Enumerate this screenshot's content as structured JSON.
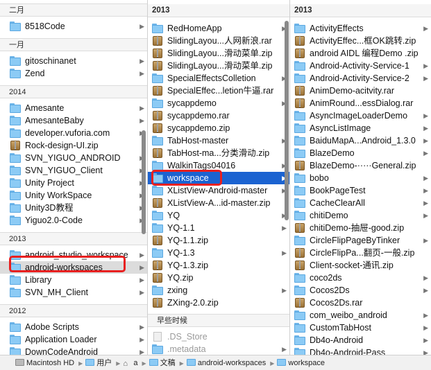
{
  "column1": {
    "sections": [
      {
        "header": "二月",
        "items": [
          {
            "label": "8518Code",
            "icon": "folder-icon",
            "arrow": true
          }
        ]
      },
      {
        "header": "一月",
        "items": [
          {
            "label": "gitoschinanet",
            "icon": "folder-icon",
            "arrow": true
          },
          {
            "label": "Zend",
            "icon": "folder-icon",
            "arrow": true
          }
        ]
      },
      {
        "header": "2014",
        "items": [
          {
            "label": "Amesante",
            "icon": "folder-icon",
            "arrow": true
          },
          {
            "label": "AmesanteBaby",
            "icon": "folder-icon",
            "arrow": true
          },
          {
            "label": "developer.vuforia.com",
            "icon": "folder-icon",
            "arrow": true
          },
          {
            "label": "Rock-design-UI.zip",
            "icon": "zip-icon",
            "arrow": false
          },
          {
            "label": "SVN_YIGUO_ANDROID",
            "icon": "folder-icon",
            "arrow": true
          },
          {
            "label": "SVN_YIGUO_Client",
            "icon": "folder-icon",
            "arrow": true
          },
          {
            "label": "Unity Project",
            "icon": "folder-icon",
            "arrow": true
          },
          {
            "label": "Unity WorkSpace",
            "icon": "folder-icon",
            "arrow": true
          },
          {
            "label": "Unity3D教程",
            "icon": "folder-icon",
            "arrow": true
          },
          {
            "label": "Yiguo2.0-Code",
            "icon": "folder-icon",
            "arrow": true
          }
        ]
      },
      {
        "header": "2013",
        "items": [
          {
            "label": "android_studio_workspace",
            "icon": "folder-icon",
            "arrow": true
          },
          {
            "label": "android-workspaces",
            "icon": "folder-icon",
            "arrow": true,
            "state": "highlighted"
          },
          {
            "label": "Library",
            "icon": "folder-icon",
            "arrow": true
          },
          {
            "label": "SVN_MH_Client",
            "icon": "folder-icon",
            "arrow": true
          }
        ]
      },
      {
        "header": "2012",
        "items": [
          {
            "label": "Adobe Scripts",
            "icon": "folder-icon",
            "arrow": true
          },
          {
            "label": "Application Loader",
            "icon": "folder-icon",
            "arrow": true
          },
          {
            "label": "DownCodeAndroid",
            "icon": "folder-icon",
            "arrow": true
          }
        ]
      }
    ]
  },
  "column2": {
    "header": "2013",
    "items": [
      {
        "label": "RedHomeApp",
        "icon": "folder-icon",
        "arrow": true
      },
      {
        "label": "SlidingLayou...人网新浪.rar",
        "icon": "zip-icon",
        "arrow": false
      },
      {
        "label": "SlidingLayou...滑动菜单.zip",
        "icon": "zip-icon",
        "arrow": false
      },
      {
        "label": "SlidingLayou...滑动菜单.zip",
        "icon": "zip-icon",
        "arrow": false
      },
      {
        "label": "SpecialEffectsColletion",
        "icon": "folder-icon",
        "arrow": true
      },
      {
        "label": "SpecialEffec...letion牛逼.rar",
        "icon": "zip-icon",
        "arrow": false
      },
      {
        "label": "sycappdemo",
        "icon": "folder-icon",
        "arrow": true
      },
      {
        "label": "sycappdemo.rar",
        "icon": "zip-icon",
        "arrow": false
      },
      {
        "label": "sycappdemo.zip",
        "icon": "zip-icon",
        "arrow": false
      },
      {
        "label": "TabHost-master",
        "icon": "folder-icon",
        "arrow": true
      },
      {
        "label": "TabHost-ma...分类滑动.zip",
        "icon": "zip-icon",
        "arrow": false
      },
      {
        "label": "WalkinTags04016",
        "icon": "folder-icon",
        "arrow": true
      },
      {
        "label": "workspace",
        "icon": "folder-icon",
        "arrow": true,
        "state": "selected"
      },
      {
        "label": "XListView-Android-master",
        "icon": "folder-icon",
        "arrow": true
      },
      {
        "label": "XListView-A...id-master.zip",
        "icon": "zip-icon",
        "arrow": false
      },
      {
        "label": "YQ",
        "icon": "folder-icon",
        "arrow": true
      },
      {
        "label": "YQ-1.1",
        "icon": "folder-icon",
        "arrow": true
      },
      {
        "label": "YQ-1.1.zip",
        "icon": "zip-icon",
        "arrow": false
      },
      {
        "label": "YQ-1.3",
        "icon": "folder-icon",
        "arrow": true
      },
      {
        "label": "YQ-1.3.zip",
        "icon": "zip-icon",
        "arrow": false
      },
      {
        "label": "YQ.zip",
        "icon": "zip-icon",
        "arrow": false
      },
      {
        "label": "zxing",
        "icon": "folder-icon",
        "arrow": true
      },
      {
        "label": "ZXing-2.0.zip",
        "icon": "zip-icon",
        "arrow": false
      }
    ],
    "section2": {
      "header": "早些时候",
      "items": [
        {
          "label": ".DS_Store",
          "icon": "document-icon",
          "arrow": false,
          "state": "dim"
        },
        {
          "label": ".metadata",
          "icon": "folder-icon",
          "arrow": true,
          "state": "dim"
        }
      ]
    }
  },
  "column3": {
    "header": "2013",
    "items": [
      {
        "label": "ActivityEffects",
        "icon": "folder-icon",
        "arrow": true
      },
      {
        "label": "ActivityEffec...框OK跳转.zip",
        "icon": "zip-icon",
        "arrow": false
      },
      {
        "label": "android AIDL 编程Demo .zip",
        "icon": "zip-icon",
        "arrow": false
      },
      {
        "label": "Android-Activity-Service-1",
        "icon": "folder-icon",
        "arrow": true
      },
      {
        "label": "Android-Activity-Service-2",
        "icon": "folder-icon",
        "arrow": true
      },
      {
        "label": "AnimDemo-acitvity.rar",
        "icon": "zip-icon",
        "arrow": false
      },
      {
        "label": "AnimRound...essDialog.rar",
        "icon": "zip-icon",
        "arrow": false
      },
      {
        "label": "AsyncImageLoaderDemo",
        "icon": "folder-icon",
        "arrow": true
      },
      {
        "label": "AsyncListImage",
        "icon": "folder-icon",
        "arrow": true
      },
      {
        "label": "BaiduMapA...Android_1.3.0",
        "icon": "folder-icon",
        "arrow": true
      },
      {
        "label": "BlazeDemo",
        "icon": "folder-icon",
        "arrow": true
      },
      {
        "label": "BlazeDemo-·····General.zip",
        "icon": "zip-icon",
        "arrow": false
      },
      {
        "label": "bobo",
        "icon": "folder-icon",
        "arrow": true
      },
      {
        "label": "BookPageTest",
        "icon": "folder-icon",
        "arrow": true
      },
      {
        "label": "CacheClearAll",
        "icon": "folder-icon",
        "arrow": true
      },
      {
        "label": "chitiDemo",
        "icon": "folder-icon",
        "arrow": true
      },
      {
        "label": "chitiDemo-抽屉-good.zip",
        "icon": "zip-icon",
        "arrow": false
      },
      {
        "label": "CircleFlipPageByTinker",
        "icon": "folder-icon",
        "arrow": true
      },
      {
        "label": "CircleFlipPa...翻页-一般.zip",
        "icon": "zip-icon",
        "arrow": false
      },
      {
        "label": "Client-socket-通讯.zip",
        "icon": "zip-icon",
        "arrow": false
      },
      {
        "label": "coco2ds",
        "icon": "folder-icon",
        "arrow": true
      },
      {
        "label": "Cocos2Ds",
        "icon": "folder-icon",
        "arrow": true
      },
      {
        "label": "Cocos2Ds.rar",
        "icon": "zip-icon",
        "arrow": false
      },
      {
        "label": "com_weibo_android",
        "icon": "folder-icon",
        "arrow": true
      },
      {
        "label": "CustomTabHost",
        "icon": "folder-icon",
        "arrow": true
      },
      {
        "label": "Db4o-Android",
        "icon": "folder-icon",
        "arrow": true
      },
      {
        "label": "Db4o-Android-Pass",
        "icon": "folder-icon",
        "arrow": true
      }
    ]
  },
  "path_bar": {
    "crumbs": [
      {
        "label": "Macintosh HD",
        "icon": "hard-drive-icon"
      },
      {
        "label": "用户",
        "icon": "folder-icon"
      },
      {
        "label": "a",
        "icon": "home-icon"
      },
      {
        "label": "文稿",
        "icon": "folder-icon"
      },
      {
        "label": "android-workspaces",
        "icon": "folder-icon"
      },
      {
        "label": "workspace",
        "icon": "folder-icon"
      }
    ]
  },
  "colors": {
    "selection": "#1b63d1",
    "highlight": "#dcdcdc",
    "annotation_box": "#e82020",
    "folder": "#8ccbf5"
  }
}
